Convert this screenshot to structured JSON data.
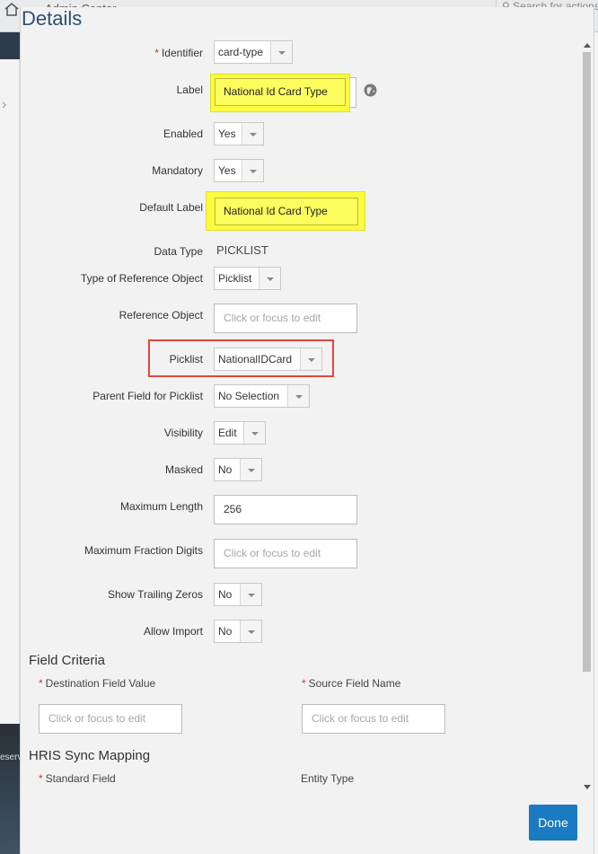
{
  "background": {
    "app_name": "Admin Center",
    "search_placeholder": "Search for actions",
    "footer_snippet": "eserv"
  },
  "dialog": {
    "title": "Details",
    "fields": {
      "identifier": {
        "label": "Identifier",
        "value": "card-type",
        "required": "*"
      },
      "label": {
        "label": "Label",
        "value": "National Id Card Type"
      },
      "enabled": {
        "label": "Enabled",
        "value": "Yes"
      },
      "mandatory": {
        "label": "Mandatory",
        "value": "Yes"
      },
      "default_label": {
        "label": "Default Label",
        "value": "National Id Card Type"
      },
      "data_type": {
        "label": "Data Type",
        "value": "PICKLIST"
      },
      "type_of_reference_object": {
        "label": "Type of Reference Object",
        "value": "Picklist"
      },
      "reference_object": {
        "label": "Reference Object",
        "placeholder": "Click or focus to edit"
      },
      "picklist": {
        "label": "Picklist",
        "value": "NationalIDCard"
      },
      "parent_field_for_picklist": {
        "label": "Parent Field for Picklist",
        "value": "No Selection"
      },
      "visibility": {
        "label": "Visibility",
        "value": "Edit"
      },
      "masked": {
        "label": "Masked",
        "value": "No"
      },
      "maximum_length": {
        "label": "Maximum Length",
        "value": "256"
      },
      "maximum_fraction_digits": {
        "label": "Maximum Fraction Digits",
        "placeholder": "Click or focus to edit"
      },
      "show_trailing_zeros": {
        "label": "Show Trailing Zeros",
        "value": "No"
      },
      "allow_import": {
        "label": "Allow Import",
        "value": "No"
      }
    },
    "field_criteria": {
      "heading": "Field Criteria",
      "destination_field_value": {
        "label": "Destination Field Value",
        "required": "*",
        "placeholder": "Click or focus to edit"
      },
      "source_field_name": {
        "label": "Source Field Name",
        "required": "*",
        "placeholder": "Click or focus to edit"
      }
    },
    "hris_sync_mapping": {
      "heading": "HRIS Sync Mapping",
      "standard_field": {
        "label": "Standard Field",
        "required": "*"
      },
      "entity_type": {
        "label": "Entity Type"
      }
    },
    "done_label": "Done"
  },
  "colors": {
    "title": "#2f4f75",
    "highlight": "#fbfc3e",
    "annotation_box": "#e0463c",
    "primary_button": "#1a7ac2",
    "required_marker": "#c0392b"
  }
}
